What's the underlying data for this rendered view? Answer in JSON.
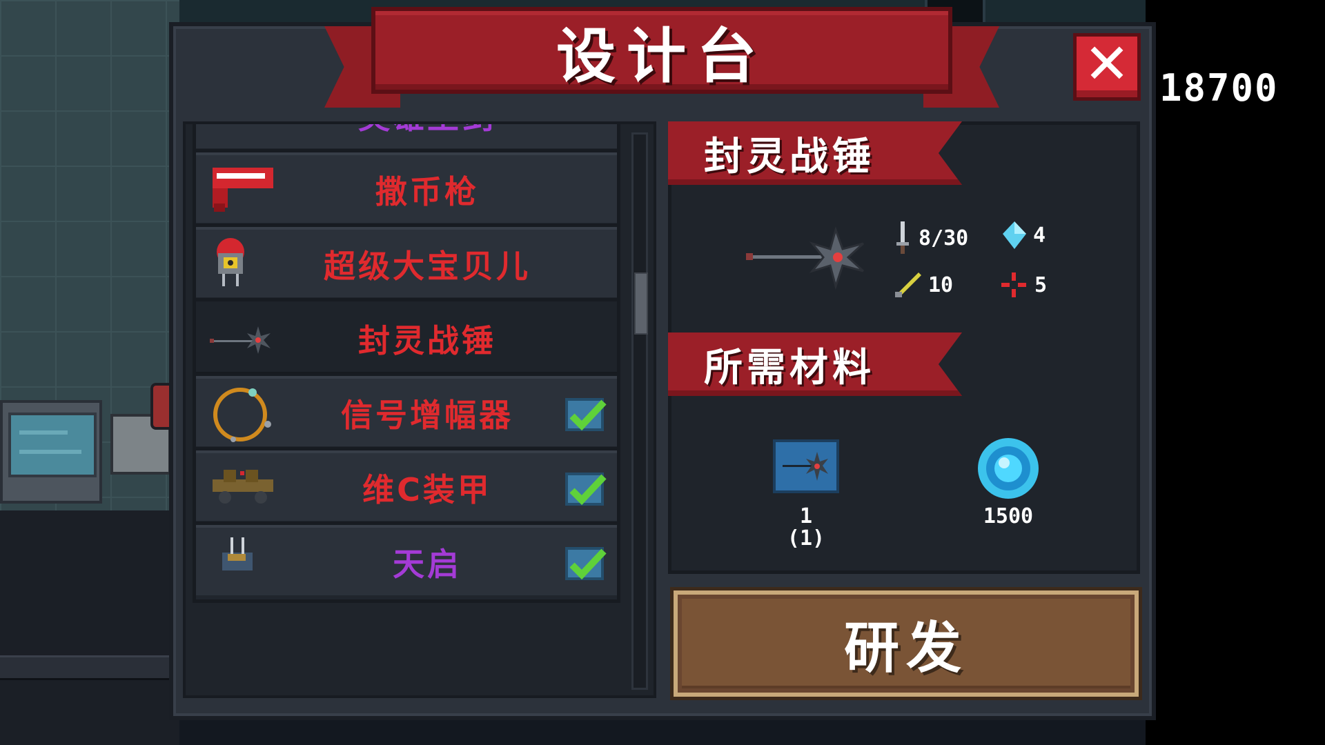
{
  "title": "设计台",
  "coins": "18700",
  "list": {
    "items": [
      {
        "name": "英雄王剑",
        "color": "#a43bd6",
        "icon": "sword-icon",
        "checked": false,
        "partial": "top"
      },
      {
        "name": "撒币枪",
        "color": "#e02a2e",
        "icon": "coin-gun-icon",
        "checked": false
      },
      {
        "name": "超级大宝贝儿",
        "color": "#e02a2e",
        "icon": "nuke-robot-icon",
        "checked": false
      },
      {
        "name": "封灵战锤",
        "color": "#e02a2e",
        "icon": "mace-icon",
        "checked": false,
        "selected": true
      },
      {
        "name": "信号增幅器",
        "color": "#e02a2e",
        "icon": "signal-ring-icon",
        "checked": true
      },
      {
        "name": "维C装甲",
        "color": "#e02a2e",
        "icon": "armor-icon",
        "checked": true
      },
      {
        "name": "天启",
        "color": "#a43bd6",
        "icon": "apocalypse-icon",
        "checked": true,
        "partial": "bottom"
      }
    ]
  },
  "detail": {
    "weapon_name": "封灵战锤",
    "stats": {
      "damage": "8/30",
      "energy": "4",
      "critical": "10",
      "accuracy": "5"
    },
    "materials_title": "所需材料",
    "materials": [
      {
        "icon": "blueprint-icon",
        "amount": "1",
        "owned": "(1)"
      },
      {
        "icon": "gem-icon",
        "amount": "1500"
      }
    ]
  },
  "develop_button": "研发",
  "colors": {
    "ribbon_red": "#9b1f28",
    "rare_red": "#e02a2e",
    "epic_purple": "#a43bd6",
    "button_brown": "#7a5436"
  }
}
